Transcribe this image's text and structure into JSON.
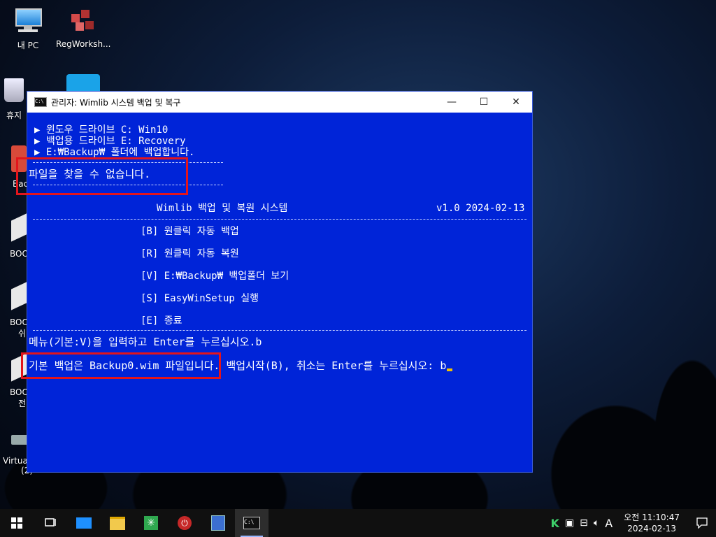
{
  "desktop": {
    "icons": [
      {
        "label": "내 PC"
      },
      {
        "label": "RegWorksh..."
      },
      {
        "label": "휴지"
      },
      {
        "label": "Bac"
      },
      {
        "label": "BOO"
      },
      {
        "label": "BOO"
      },
      {
        "label": "쉬"
      },
      {
        "label": "BOO"
      },
      {
        "label": "전"
      },
      {
        "label": "Virtua"
      },
      {
        "label": "(2)"
      }
    ]
  },
  "window": {
    "title": "관리자:  Wimlib 시스템 백업 및 복구",
    "minimize": "—",
    "maximize": "☐",
    "close": "✕",
    "console": {
      "info_line_1": "▶ 윈도우 드라이브 C: Win10",
      "info_line_2": "▶ 백업용 드라이브 E: Recovery",
      "info_line_3": "▶ E:₩Backup₩ 폴더에 백업합니다.",
      "error_line": "파일을 찾을 수 없습니다.",
      "header_title": "Wimlib 백업 및 복원 시스템",
      "header_version": "v1.0 2024-02-13",
      "menu": [
        "[B] 원클릭 자동 백업",
        "[R] 원클릭 자동 복원",
        "[V] E:₩Backup₩ 백업폴더 보기",
        "[S] EasyWinSetup 실행",
        "[E] 종료"
      ],
      "prompt_line": "메뉴(기본:V)을 입력하고 Enter를 누르십시오.b",
      "backup_line_highlight": "기본 백업은 Backup0.wim 파일입니다.",
      "backup_line_rest": " 백업시작(B), 취소는 Enter를 누르십시오: b"
    }
  },
  "taskbar": {
    "ime": "A",
    "time": "오전 11:10:47",
    "date": "2024-02-13"
  }
}
